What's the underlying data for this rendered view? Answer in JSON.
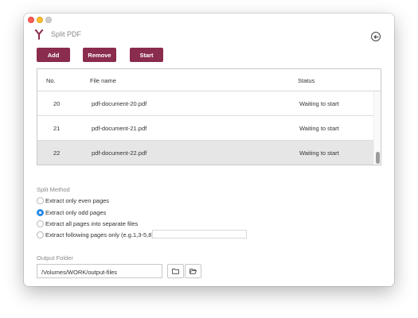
{
  "window": {
    "title": "Split PDF"
  },
  "toolbar": {
    "add_label": "Add",
    "remove_label": "Remove",
    "start_label": "Start"
  },
  "table": {
    "columns": {
      "no": "No.",
      "file": "File name",
      "status": "Status"
    },
    "rows": [
      {
        "no": "20",
        "file": "pdf-document-20.pdf",
        "status": "Waiting to start",
        "selected": false
      },
      {
        "no": "21",
        "file": "pdf-document-21.pdf",
        "status": "Waiting to start",
        "selected": false
      },
      {
        "no": "22",
        "file": "pdf-document-22.pdf",
        "status": "Waiting to start",
        "selected": true
      }
    ]
  },
  "split_method": {
    "label": "Split Method",
    "options": [
      {
        "label": "Extract only even pages",
        "checked": false
      },
      {
        "label": "Extract only odd pages",
        "checked": true
      },
      {
        "label": "Extract all pages into separate files",
        "checked": false
      },
      {
        "label": "Extract following pages only (e.g.1,3-5,8)",
        "checked": false
      }
    ],
    "pages_value": ""
  },
  "output": {
    "label": "Output Folder",
    "path": "/Volumes/WORK/output-files"
  },
  "colors": {
    "accent": "#8a2c4e",
    "radio_selected": "#2b8be6",
    "row_selected": "#e6e6e6"
  },
  "icons": {
    "logo": "split-logo-icon",
    "back": "back-arrow-icon",
    "folder": "folder-icon",
    "folder_open": "folder-open-icon"
  }
}
